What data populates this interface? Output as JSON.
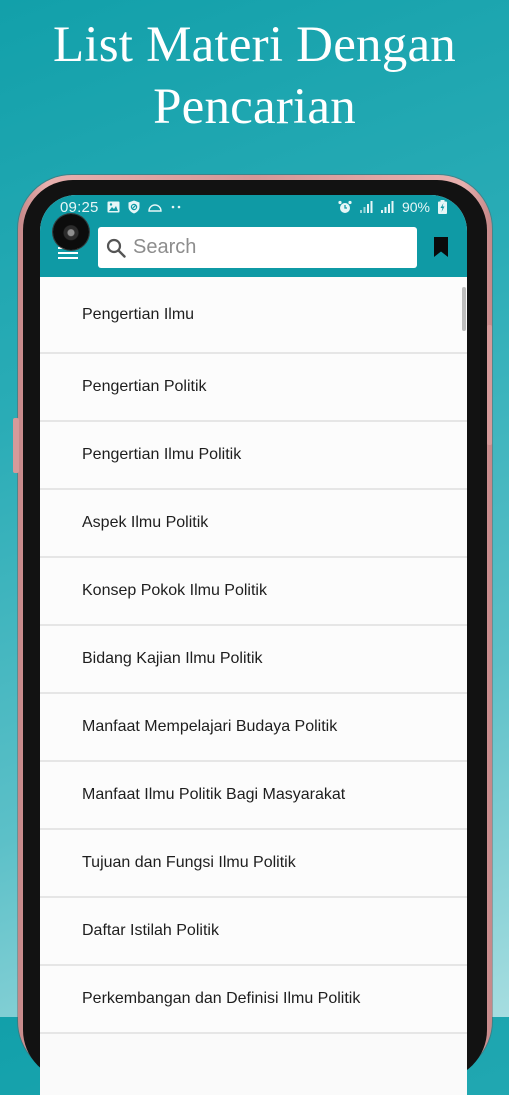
{
  "promo": {
    "title_line1": "List Materi Dengan",
    "title_line2": "Pencarian"
  },
  "status_bar": {
    "time": "09:25",
    "left_icons": [
      "image-icon",
      "shield-icon",
      "dome-icon",
      "more-dots-icon"
    ],
    "right_icons": [
      "alarm-icon",
      "signal-icon",
      "signal-icon"
    ],
    "battery_percent": "90%",
    "battery_charging": true
  },
  "app_bar": {
    "menu_icon": "hamburger-menu-icon",
    "search": {
      "placeholder": "Search",
      "value": ""
    },
    "bookmark_icon": "bookmark-icon"
  },
  "colors": {
    "primary": "#0f9aa5",
    "background_gradient_start": "#12a0aa",
    "background_gradient_end": "#a6dde0",
    "phone_frame": "#d59898",
    "list_text": "#1e1e1e",
    "divider": "#e6e6e6"
  },
  "list": {
    "items": [
      {
        "label": "Pengertian Ilmu"
      },
      {
        "label": "Pengertian Politik"
      },
      {
        "label": "Pengertian Ilmu Politik"
      },
      {
        "label": "Aspek Ilmu Politik"
      },
      {
        "label": "Konsep Pokok Ilmu Politik"
      },
      {
        "label": "Bidang Kajian Ilmu Politik"
      },
      {
        "label": "Manfaat Mempelajari Budaya Politik"
      },
      {
        "label": "Manfaat Ilmu Politik Bagi Masyarakat"
      },
      {
        "label": "Tujuan dan Fungsi Ilmu Politik"
      },
      {
        "label": "Daftar Istilah Politik"
      },
      {
        "label": "Perkembangan dan Definisi Ilmu Politik"
      }
    ]
  }
}
